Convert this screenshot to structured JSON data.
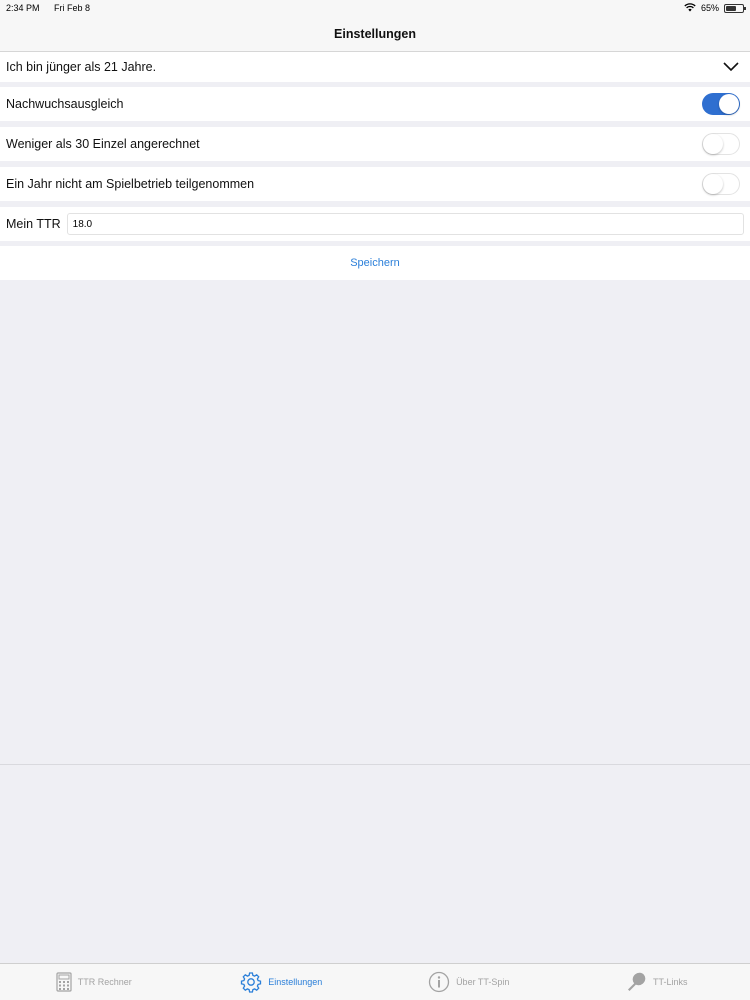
{
  "status_bar": {
    "time": "2:34 PM",
    "date": "Fri Feb 8",
    "battery": "65%",
    "battery_level": 0.65,
    "wifi_icon": "wifi-icon"
  },
  "nav": {
    "title": "Einstellungen"
  },
  "settings": {
    "age_select": {
      "value": "Ich bin jünger als 21 Jahre.",
      "icon": "chevron-down-icon"
    },
    "nachwuchs": {
      "label": "Nachwuchsausgleich",
      "on": true
    },
    "weniger30": {
      "label": "Weniger als 30 Einzel angerechnet",
      "on": false
    },
    "einjahr": {
      "label": "Ein Jahr nicht am Spielbetrieb teilgenommen",
      "on": false
    },
    "ttr": {
      "label": "Mein TTR",
      "value": "18.0"
    },
    "save_label": "Speichern"
  },
  "tabs": [
    {
      "label": "TTR Rechner",
      "icon": "calculator-icon",
      "active": false
    },
    {
      "label": "Einstellungen",
      "icon": "gear-icon",
      "active": true
    },
    {
      "label": "Über TT-Spin",
      "icon": "info-icon",
      "active": false
    },
    {
      "label": "TT-Links",
      "icon": "paddle-icon",
      "active": false
    }
  ],
  "colors": {
    "accent": "#2b7fd9",
    "toggle_on": "#2f6fd0",
    "background": "#efeff4"
  }
}
